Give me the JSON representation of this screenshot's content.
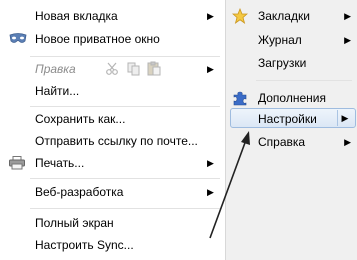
{
  "left_menu": {
    "new_tab": "Новая вкладка",
    "private_window": "Новое приватное окно",
    "edit": "Правка",
    "find": "Найти...",
    "save_as": "Сохранить как...",
    "send_link": "Отправить ссылку по почте...",
    "print": "Печать...",
    "web_dev": "Веб-разработка",
    "fullscreen": "Полный экран",
    "sync": "Настроить Sync..."
  },
  "right_menu": {
    "bookmarks": "Закладки",
    "history": "Журнал",
    "downloads": "Загрузки",
    "addons": "Дополнения",
    "settings": "Настройки",
    "help": "Справка"
  },
  "arrow_glyph": "▶",
  "colors": {
    "highlight_fill": "#dbe7f5",
    "highlight_border": "#9fbcdf",
    "disabled_text": "#8c8c8c"
  }
}
